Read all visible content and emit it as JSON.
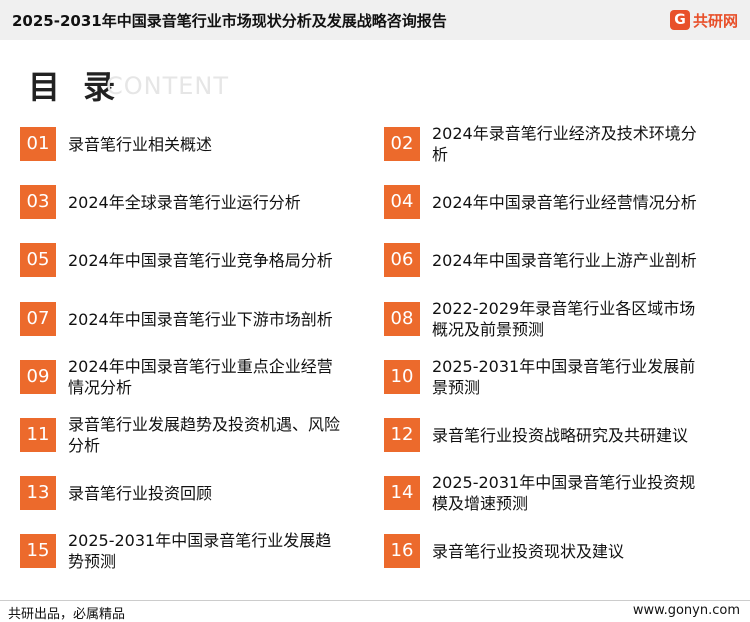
{
  "header": {
    "title": "2025-2031年中国录音笔行业市场现状分析及发展战略咨询报告",
    "brand_icon": "G",
    "brand_text": "共研网"
  },
  "toc": {
    "title": "目 录",
    "subtitle": "CONTENT",
    "items": [
      {
        "num": "01",
        "label": "录音笔行业相关概述"
      },
      {
        "num": "02",
        "label": "2024年录音笔行业经济及技术环境分析"
      },
      {
        "num": "03",
        "label": "2024年全球录音笔行业运行分析"
      },
      {
        "num": "04",
        "label": "2024年中国录音笔行业经营情况分析"
      },
      {
        "num": "05",
        "label": "2024年中国录音笔行业竞争格局分析"
      },
      {
        "num": "06",
        "label": "2024年中国录音笔行业上游产业剖析"
      },
      {
        "num": "07",
        "label": "2024年中国录音笔行业下游市场剖析"
      },
      {
        "num": "08",
        "label": "2022-2029年录音笔行业各区域市场概况及前景预测"
      },
      {
        "num": "09",
        "label": "2024年中国录音笔行业重点企业经营情况分析"
      },
      {
        "num": "10",
        "label": "2025-2031年中国录音笔行业发展前景预测"
      },
      {
        "num": "11",
        "label": "录音笔行业发展趋势及投资机遇、风险分析"
      },
      {
        "num": "12",
        "label": "录音笔行业投资战略研究及共研建议"
      },
      {
        "num": "13",
        "label": "录音笔行业投资回顾"
      },
      {
        "num": "14",
        "label": "2025-2031年中国录音笔行业投资规模及增速预测"
      },
      {
        "num": "15",
        "label": "2025-2031年中国录音笔行业发展趋势预测"
      },
      {
        "num": "16",
        "label": "录音笔行业投资现状及建议"
      }
    ]
  },
  "footer": {
    "slogan": "共研出品，必属精品",
    "url": "www.gonyn.com"
  },
  "colors": {
    "accent": "#ec6a2c",
    "brand": "#e8502a",
    "header_bg": "#f0f0f0"
  }
}
